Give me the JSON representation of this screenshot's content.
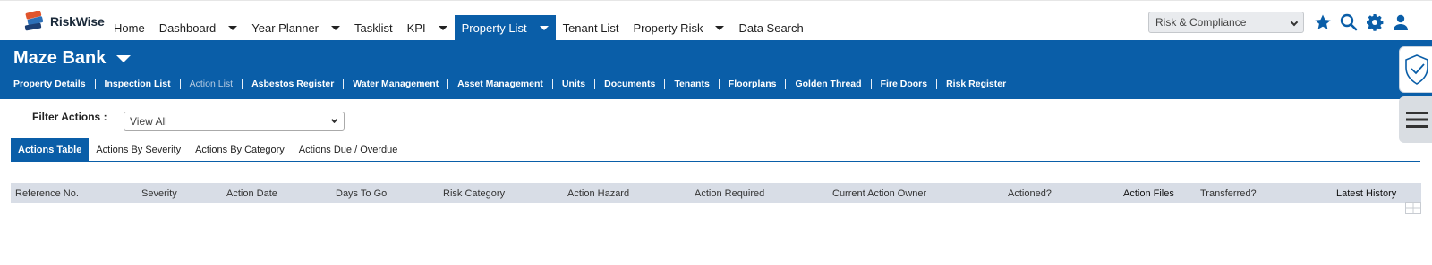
{
  "app": {
    "logo_text": "RiskWise"
  },
  "nav": {
    "items": [
      {
        "label": "Home",
        "dropdown": false,
        "active": false
      },
      {
        "label": "Dashboard",
        "dropdown": true,
        "active": false
      },
      {
        "label": "Year Planner",
        "dropdown": true,
        "active": false
      },
      {
        "label": "Tasklist",
        "dropdown": false,
        "active": false
      },
      {
        "label": "KPI",
        "dropdown": true,
        "active": false
      },
      {
        "label": "Property List",
        "dropdown": true,
        "active": true
      },
      {
        "label": "Tenant List",
        "dropdown": false,
        "active": false
      },
      {
        "label": "Property Risk",
        "dropdown": true,
        "active": false
      },
      {
        "label": "Data Search",
        "dropdown": false,
        "active": false
      }
    ],
    "module_select": "Risk & Compliance",
    "icons": [
      "star-icon",
      "search-icon",
      "gear-icon",
      "user-icon"
    ]
  },
  "property": {
    "title": "Maze Bank",
    "subnav": [
      {
        "label": "Property Details",
        "current": false
      },
      {
        "label": "Inspection List",
        "current": false
      },
      {
        "label": "Action List",
        "current": true
      },
      {
        "label": "Asbestos Register",
        "current": false
      },
      {
        "label": "Water Management",
        "current": false
      },
      {
        "label": "Asset Management",
        "current": false
      },
      {
        "label": "Units",
        "current": false
      },
      {
        "label": "Documents",
        "current": false
      },
      {
        "label": "Tenants",
        "current": false
      },
      {
        "label": "Floorplans",
        "current": false
      },
      {
        "label": "Golden Thread",
        "current": false
      },
      {
        "label": "Fire Doors",
        "current": false
      },
      {
        "label": "Risk Register",
        "current": false
      }
    ]
  },
  "filter": {
    "label": "Filter Actions :",
    "value": "View All"
  },
  "tabs": [
    {
      "label": "Actions Table",
      "active": true
    },
    {
      "label": "Actions By Severity",
      "active": false
    },
    {
      "label": "Actions By Category",
      "active": false
    },
    {
      "label": "Actions Due / Overdue",
      "active": false
    }
  ],
  "table": {
    "columns": [
      "Reference No.",
      "Severity",
      "Action Date",
      "Days To Go",
      "Risk Category",
      "Action Hazard",
      "Action Required",
      "Current Action Owner",
      "Actioned?",
      "Action Files",
      "Transferred?",
      "Latest History"
    ]
  },
  "colors": {
    "brand_blue": "#0a5ea8",
    "table_header": "#d8dde6"
  }
}
